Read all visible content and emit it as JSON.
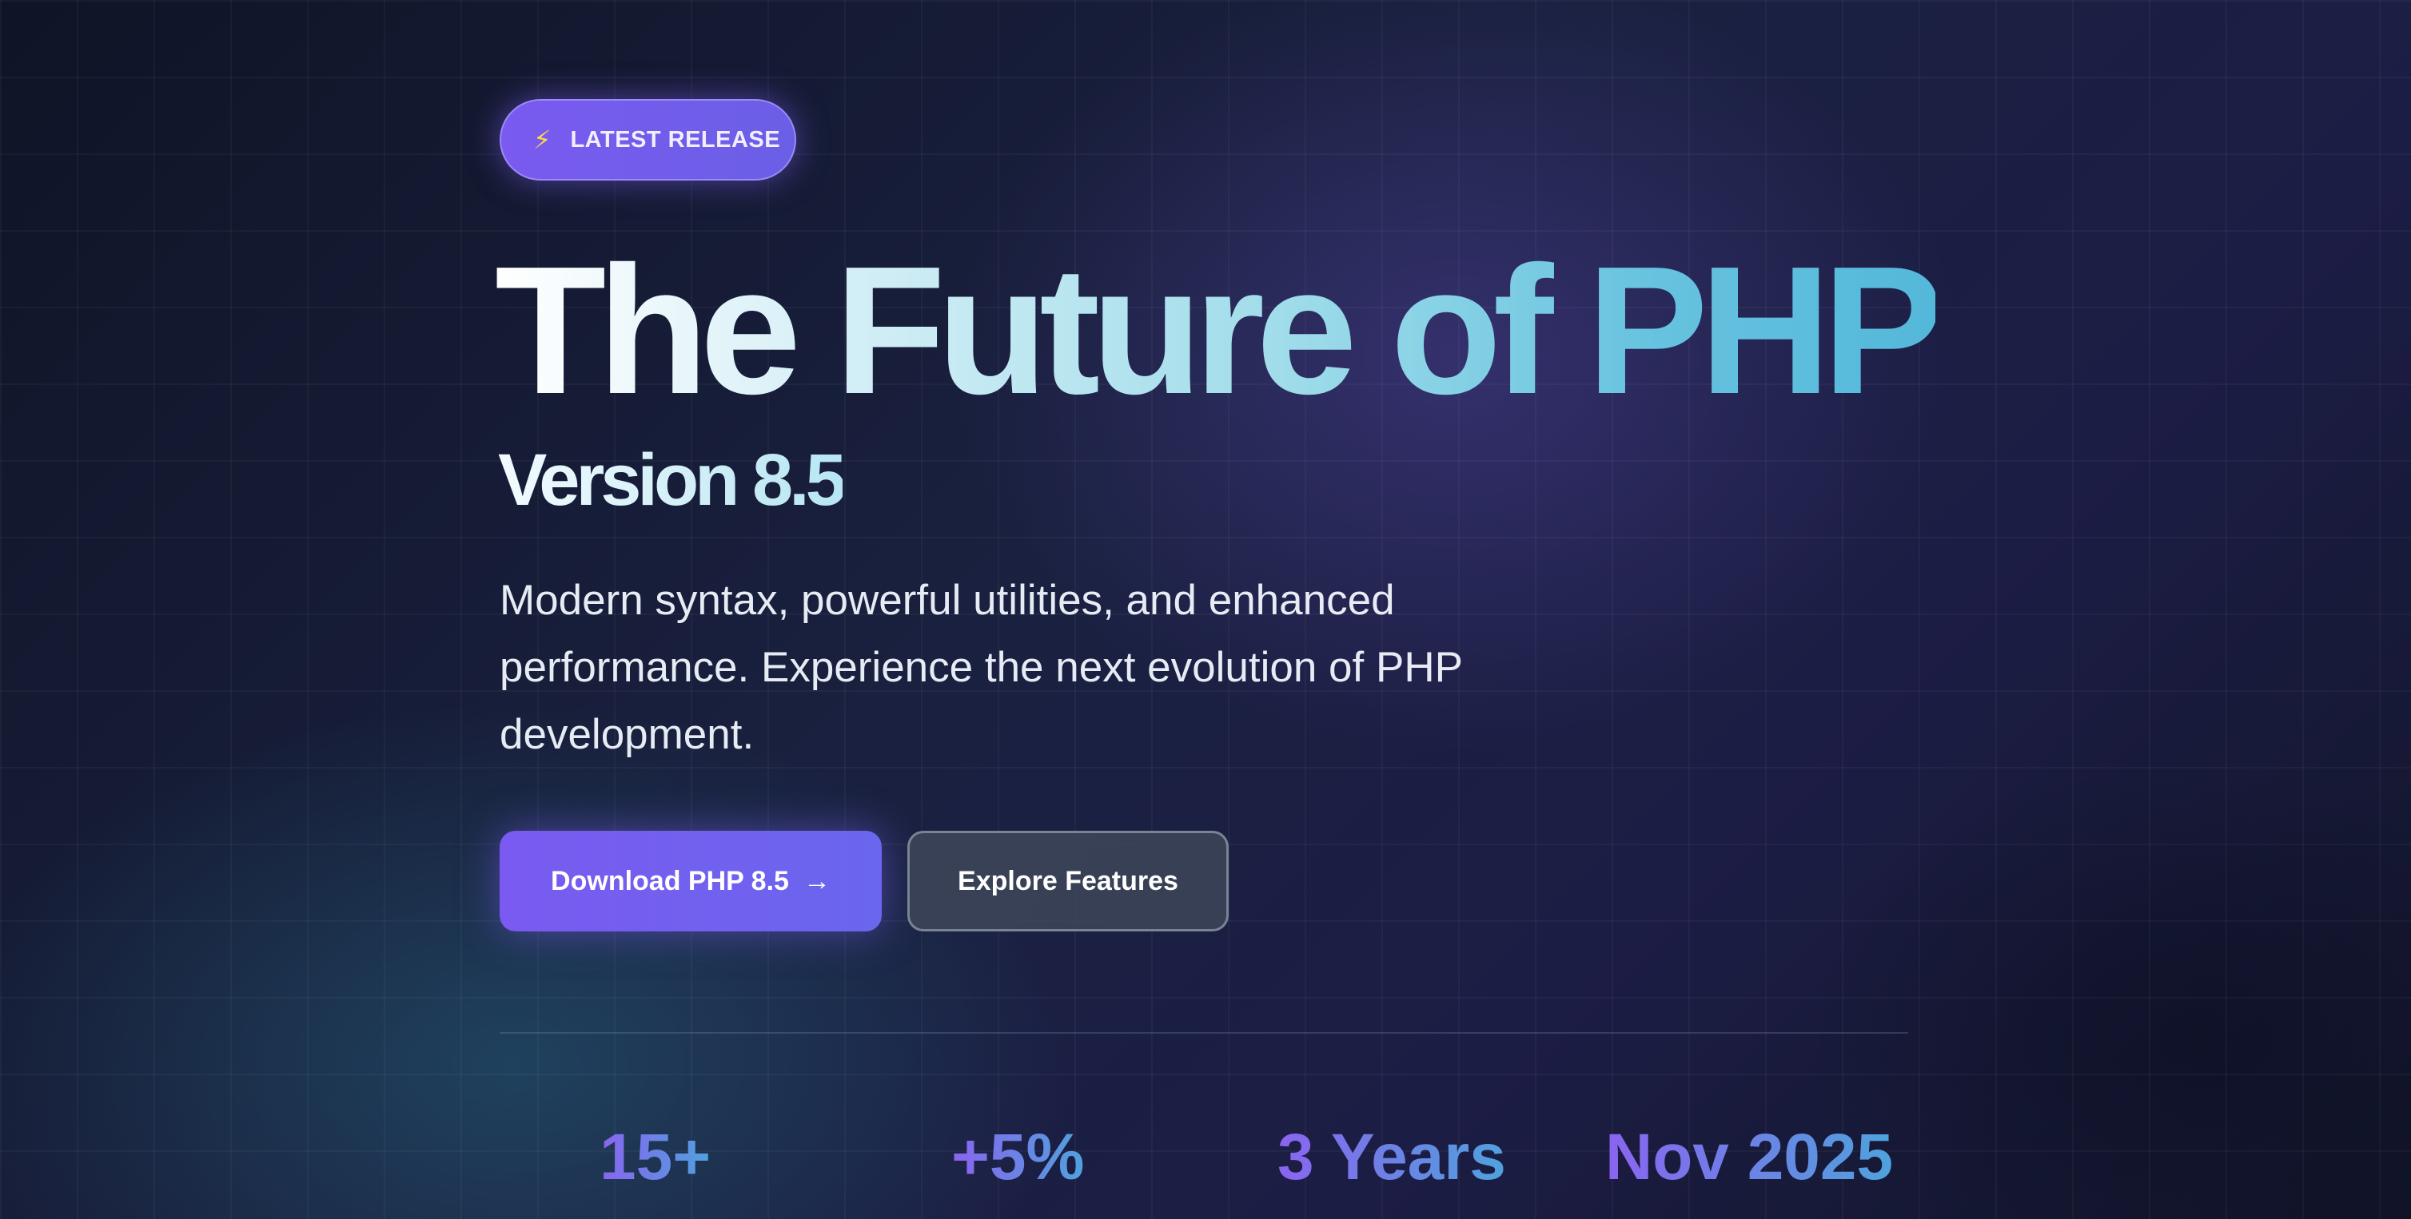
{
  "badge": {
    "icon": "lightning-icon",
    "label": "LATEST RELEASE"
  },
  "hero": {
    "title": "The Future of PHP",
    "subtitle": "Version 8.5",
    "description": "Modern syntax, powerful utilities, and enhanced performance. Experience the next evolution of PHP development."
  },
  "buttons": {
    "download_label": "Download PHP 8.5",
    "download_icon": "arrow-right-icon",
    "explore_label": "Explore Features"
  },
  "stats": [
    {
      "value": "15+"
    },
    {
      "value": "+5%"
    },
    {
      "value": "3 Years"
    },
    {
      "value": "Nov 2025"
    }
  ],
  "colors": {
    "accent_purple": "#7a5af0",
    "accent_cyan": "#54b8da",
    "badge_icon": "#ffd84a"
  }
}
